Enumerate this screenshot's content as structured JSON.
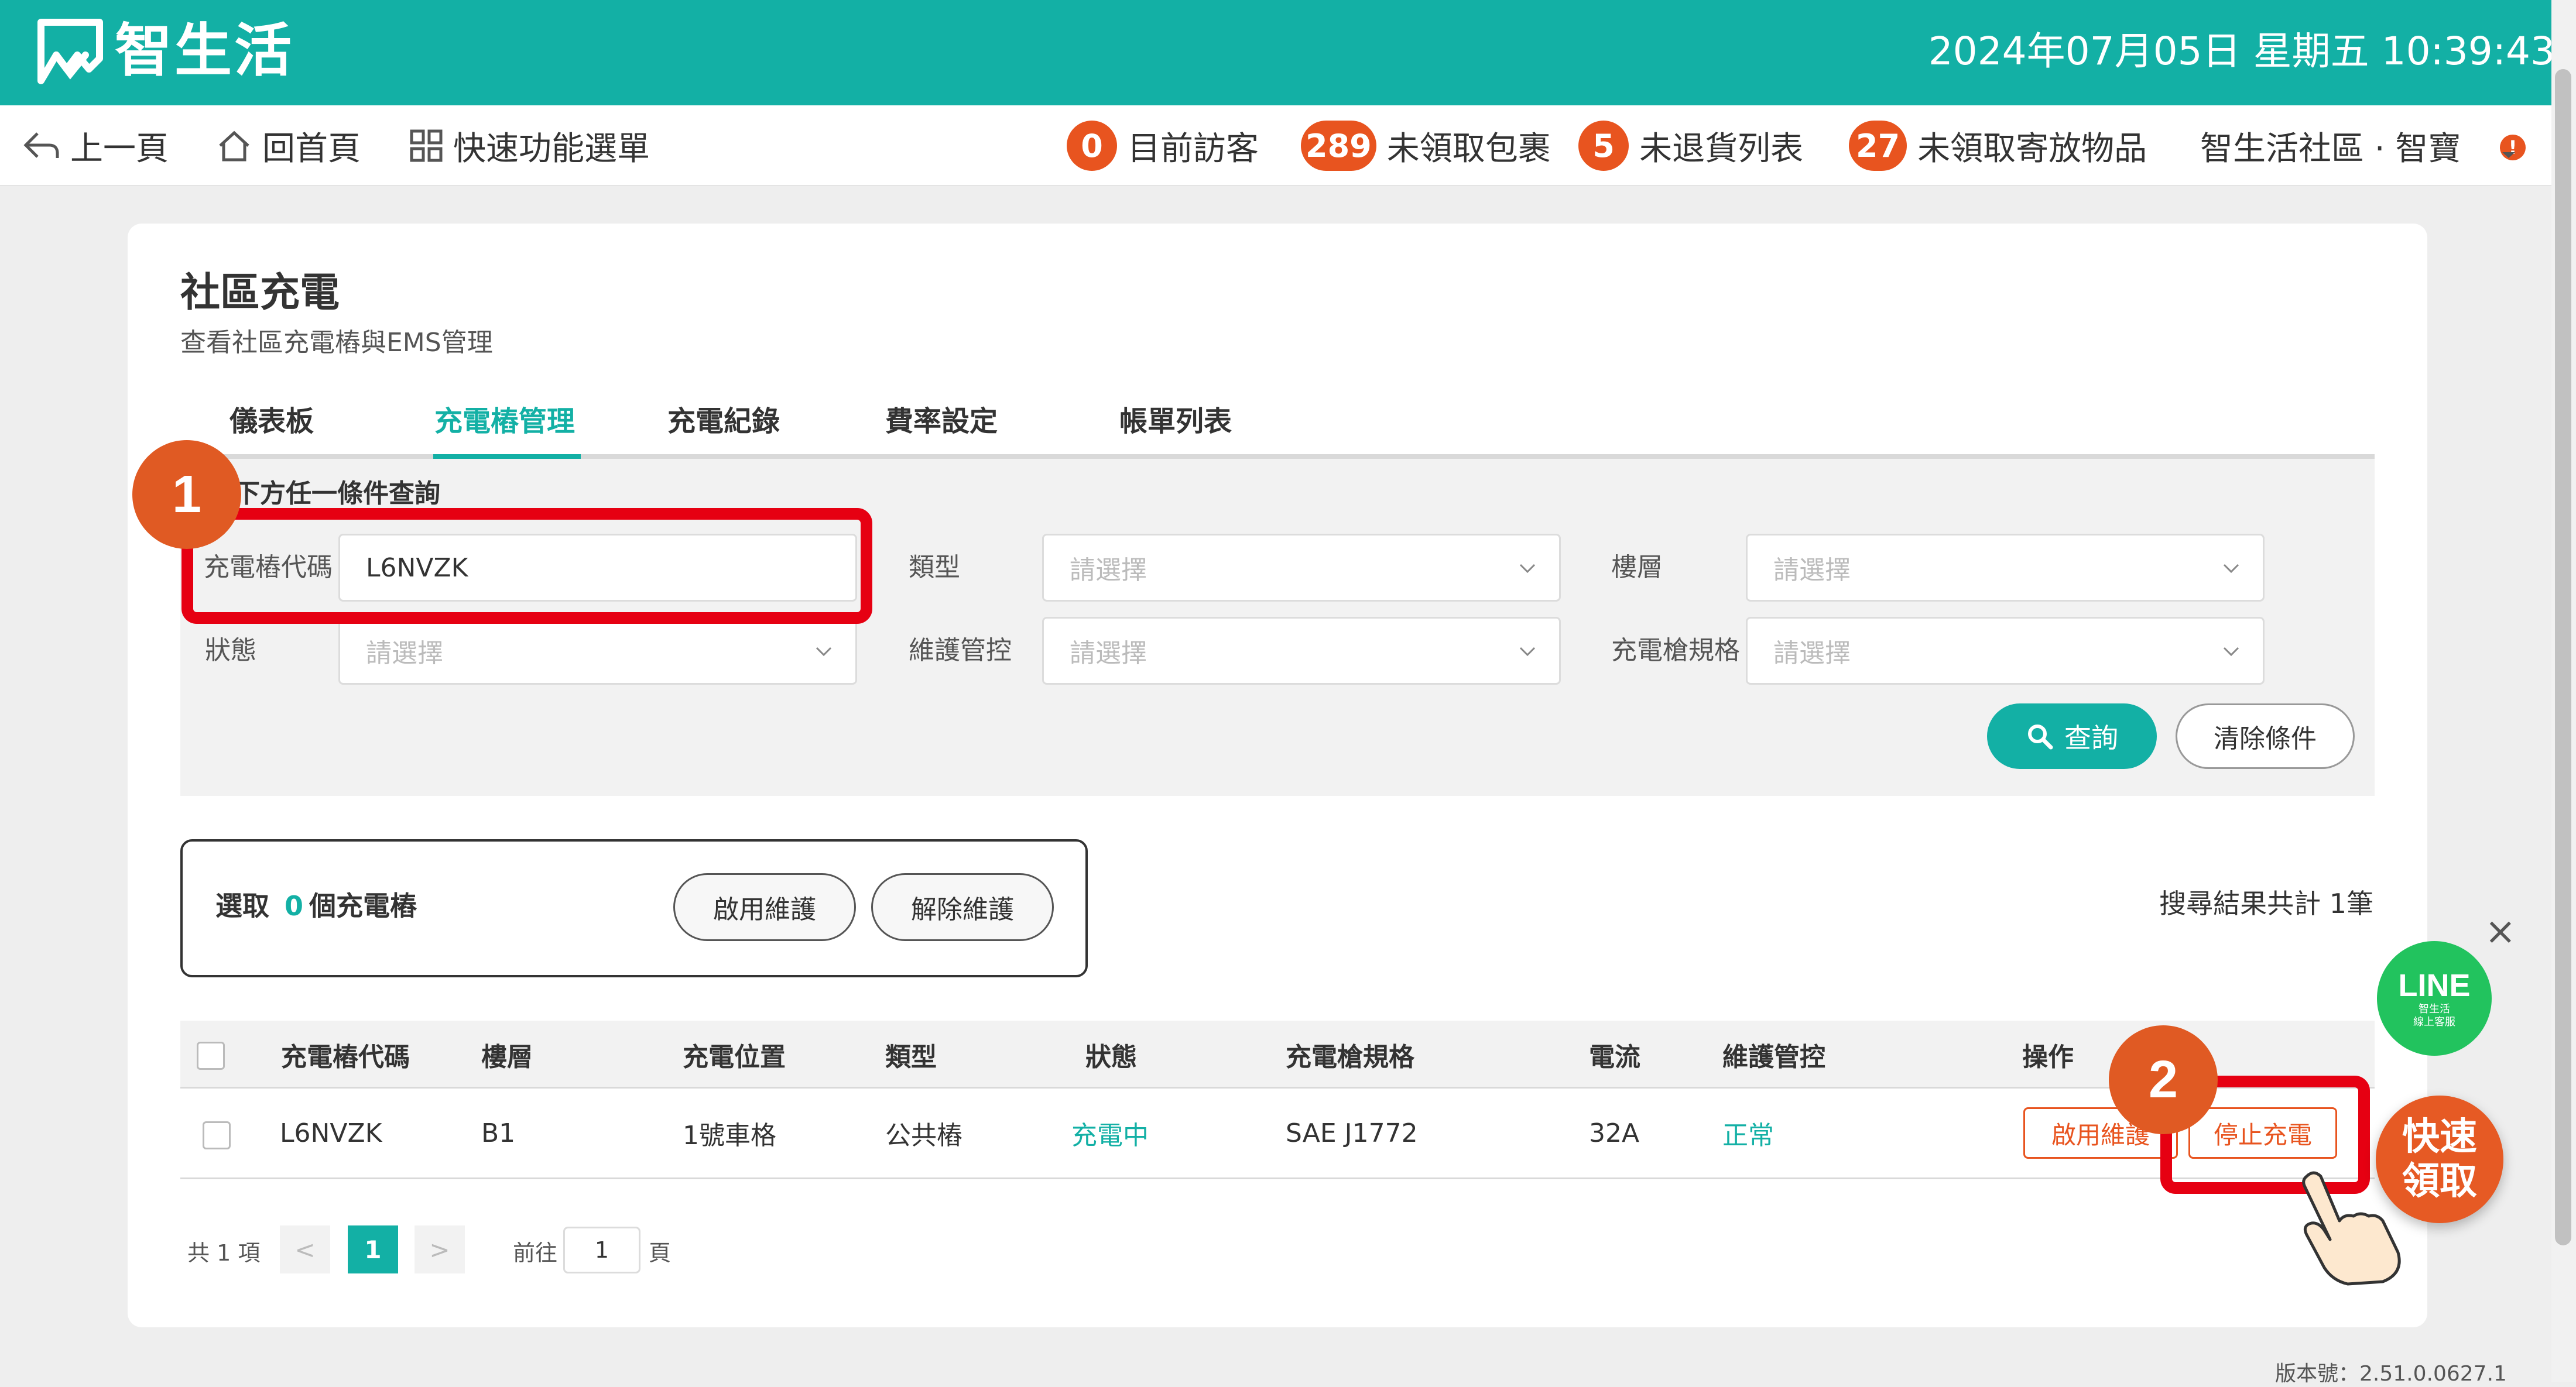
{
  "header": {
    "logo_text": "智生活",
    "datetime": "2024年07月05日 星期五 10:39:43"
  },
  "nav": {
    "back": "上一頁",
    "home": "回首頁",
    "menu": "快速功能選單",
    "visitors_count": "0",
    "visitors_label": "目前訪客",
    "packages_count": "289",
    "packages_label": "未領取包裹",
    "returns_count": "5",
    "returns_label": "未退貨列表",
    "storage_count": "27",
    "storage_label": "未領取寄放物品",
    "community": "智生活社區 · 智寶",
    "notify_badge": "!"
  },
  "page": {
    "title": "社區充電",
    "subtitle": "查看社區充電樁與EMS管理"
  },
  "tabs": [
    {
      "label": "儀表板"
    },
    {
      "label": "充電樁管理"
    },
    {
      "label": "充電紀錄"
    },
    {
      "label": "費率設定"
    },
    {
      "label": "帳單列表"
    }
  ],
  "filter": {
    "hint": "下方任一條件查詢",
    "code_label": "充電樁代碼",
    "code_value": "L6NVZK",
    "type_label": "類型",
    "floor_label": "樓層",
    "status_label": "狀態",
    "maint_label": "維護管控",
    "spec_label": "充電槍規格",
    "placeholder": "請選擇",
    "search_btn": "查詢",
    "clear_btn": "清除條件"
  },
  "selection": {
    "prefix": "選取",
    "count": "0",
    "suffix": "個充電樁",
    "enable_btn": "啟用維護",
    "disable_btn": "解除維護",
    "result_text": "搜尋結果共計 1筆"
  },
  "table": {
    "headers": [
      "充電樁代碼",
      "樓層",
      "充電位置",
      "類型",
      "狀態",
      "充電槍規格",
      "電流",
      "維護管控",
      "操作"
    ],
    "rows": [
      {
        "code": "L6NVZK",
        "floor": "B1",
        "location": "1號車格",
        "type": "公共樁",
        "status": "充電中",
        "spec": "SAE J1772",
        "current": "32A",
        "maintenance": "正常",
        "action_enable": "啟用維護",
        "action_stop": "停止充電"
      }
    ]
  },
  "pager": {
    "total": "共 1 項",
    "prev": "<",
    "current": "1",
    "next": ">",
    "goto_label": "前往",
    "goto_value": "1",
    "page_unit": "頁"
  },
  "version": "版本號：2.51.0.0627.1",
  "annotations": {
    "step1": "1",
    "step2": "2"
  },
  "floats": {
    "line_title": "LINE",
    "line_sub1": "智生活",
    "line_sub2": "線上客服",
    "quick_line1": "快速",
    "quick_line2": "領取",
    "close": "×"
  },
  "colors": {
    "brand": "#13b0a5",
    "badge": "#e8541f",
    "highlight": "#e60012"
  }
}
